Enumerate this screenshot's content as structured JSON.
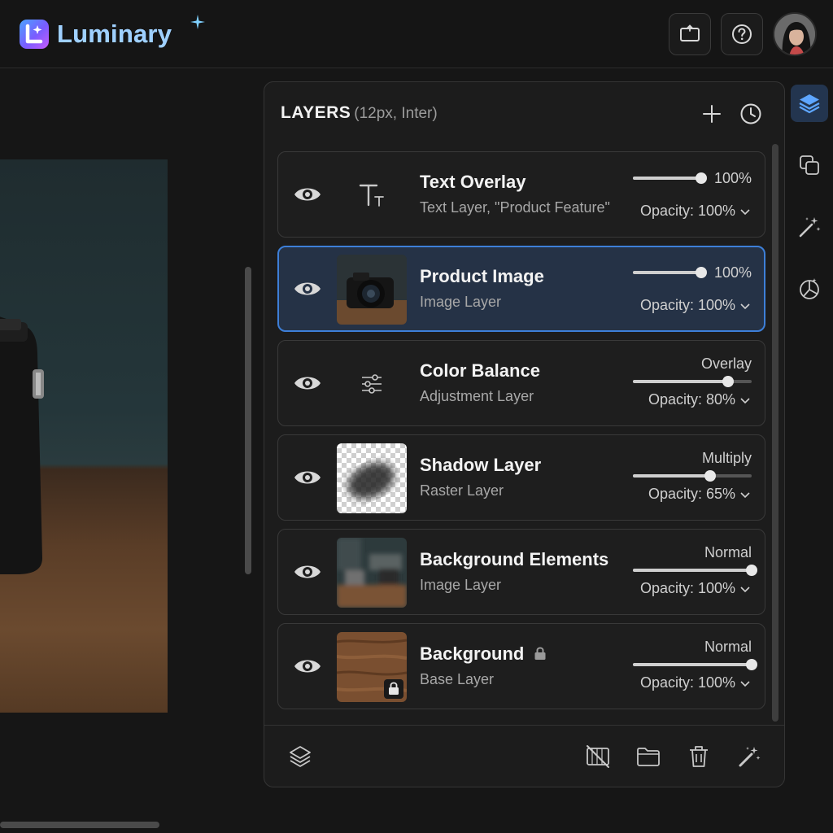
{
  "app": {
    "name": "Luminary",
    "accent": "#3d7fd8"
  },
  "header": {
    "buttons": [
      {
        "icon": "screen-share-icon"
      },
      {
        "icon": "help-icon"
      }
    ],
    "avatar": {
      "icon": "user-avatar"
    }
  },
  "panel": {
    "title": "LAYERS",
    "title_note": "(12px, Inter)",
    "actions": [
      {
        "icon": "plus-icon"
      },
      {
        "icon": "history-icon"
      }
    ],
    "layers": [
      {
        "name": "Text Overlay",
        "subtitle": "Text Layer, \"Product Feature\"",
        "blend": "",
        "percent": "100%",
        "opacity": "Opacity: 100%",
        "opacity_value": 100,
        "thumb": "text-icon",
        "selected": false,
        "locked": false
      },
      {
        "name": "Product Image",
        "subtitle": "Image Layer",
        "blend": "",
        "percent": "100%",
        "opacity": "Opacity: 100%",
        "opacity_value": 100,
        "thumb": "camera-photo",
        "selected": true,
        "locked": false
      },
      {
        "name": "Color Balance",
        "subtitle": "Adjustment Layer",
        "blend": "Overlay",
        "percent": "",
        "opacity": "Opacity: 80%",
        "opacity_value": 80,
        "thumb": "sliders-icon",
        "selected": false,
        "locked": false
      },
      {
        "name": "Shadow Layer",
        "subtitle": "Raster Layer",
        "blend": "Multiply",
        "percent": "",
        "opacity": "Opacity: 65%",
        "opacity_value": 65,
        "thumb": "shadow-raster",
        "selected": false,
        "locked": false
      },
      {
        "name": "Background Elements",
        "subtitle": "Image Layer",
        "blend": "Normal",
        "percent": "",
        "opacity": "Opacity: 100%",
        "opacity_value": 100,
        "thumb": "blurred-photo",
        "selected": false,
        "locked": false
      },
      {
        "name": "Background",
        "subtitle": "Base Layer",
        "blend": "Normal",
        "percent": "",
        "opacity": "Opacity: 100%",
        "opacity_value": 100,
        "thumb": "wood-texture",
        "selected": false,
        "locked": true
      }
    ],
    "footer_actions": [
      {
        "icon": "layers-stack-icon"
      },
      {
        "icon": "mask-off-icon"
      },
      {
        "icon": "folder-icon"
      },
      {
        "icon": "trash-icon"
      },
      {
        "icon": "magic-wand-icon"
      }
    ]
  },
  "toolbar": [
    {
      "icon": "layers-icon",
      "active": true
    },
    {
      "icon": "duplicate-icon",
      "active": false
    },
    {
      "icon": "magic-wand-icon",
      "active": false
    },
    {
      "icon": "color-adjust-icon",
      "active": false
    }
  ]
}
